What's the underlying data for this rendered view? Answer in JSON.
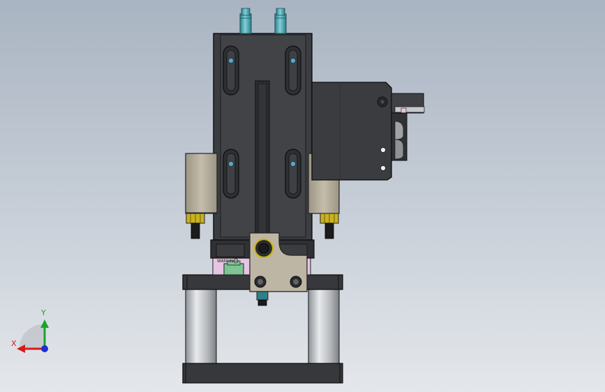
{
  "viewport": {
    "background_top": "#a9b4c2",
    "background_bottom": "#e4e7eb"
  },
  "model": {
    "body_color": "#3b3d41",
    "edge_color": "#111111",
    "slot_color": "#2a2c2f",
    "plate_color": "#bdb6a4",
    "rod_color": "#c3c6c9",
    "fitting_color": "#4fa6b0",
    "bolt_color": "#5aa8c4",
    "nut_color": "#c9b21e",
    "accent_pink": "#e5c5e3",
    "accent_green": "#7ec495",
    "label_text": "WANHN"
  },
  "triad": {
    "x_label": "X",
    "y_label": "Y",
    "x_color": "#d51c1c",
    "y_color": "#17a52d",
    "z_color": "#1d2fd6"
  }
}
